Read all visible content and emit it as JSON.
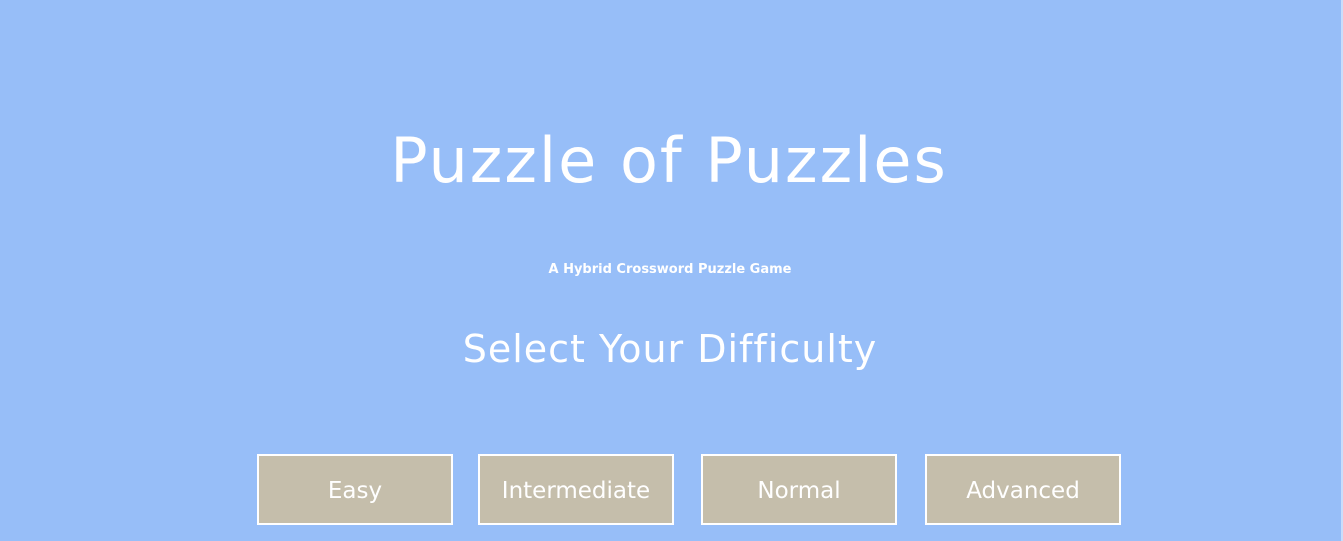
{
  "game": {
    "title": "Puzzle of Puzzles",
    "subtitle": "A Hybrid Crossword Puzzle Game",
    "prompt": "Select Your Difficulty"
  },
  "difficulty": {
    "options": [
      {
        "label": "Easy"
      },
      {
        "label": "Intermediate"
      },
      {
        "label": "Normal"
      },
      {
        "label": "Advanced"
      }
    ]
  },
  "colors": {
    "background": "#97bef8",
    "button_fill": "#c5beab",
    "button_border": "#ffffff",
    "text": "#ffffff"
  }
}
